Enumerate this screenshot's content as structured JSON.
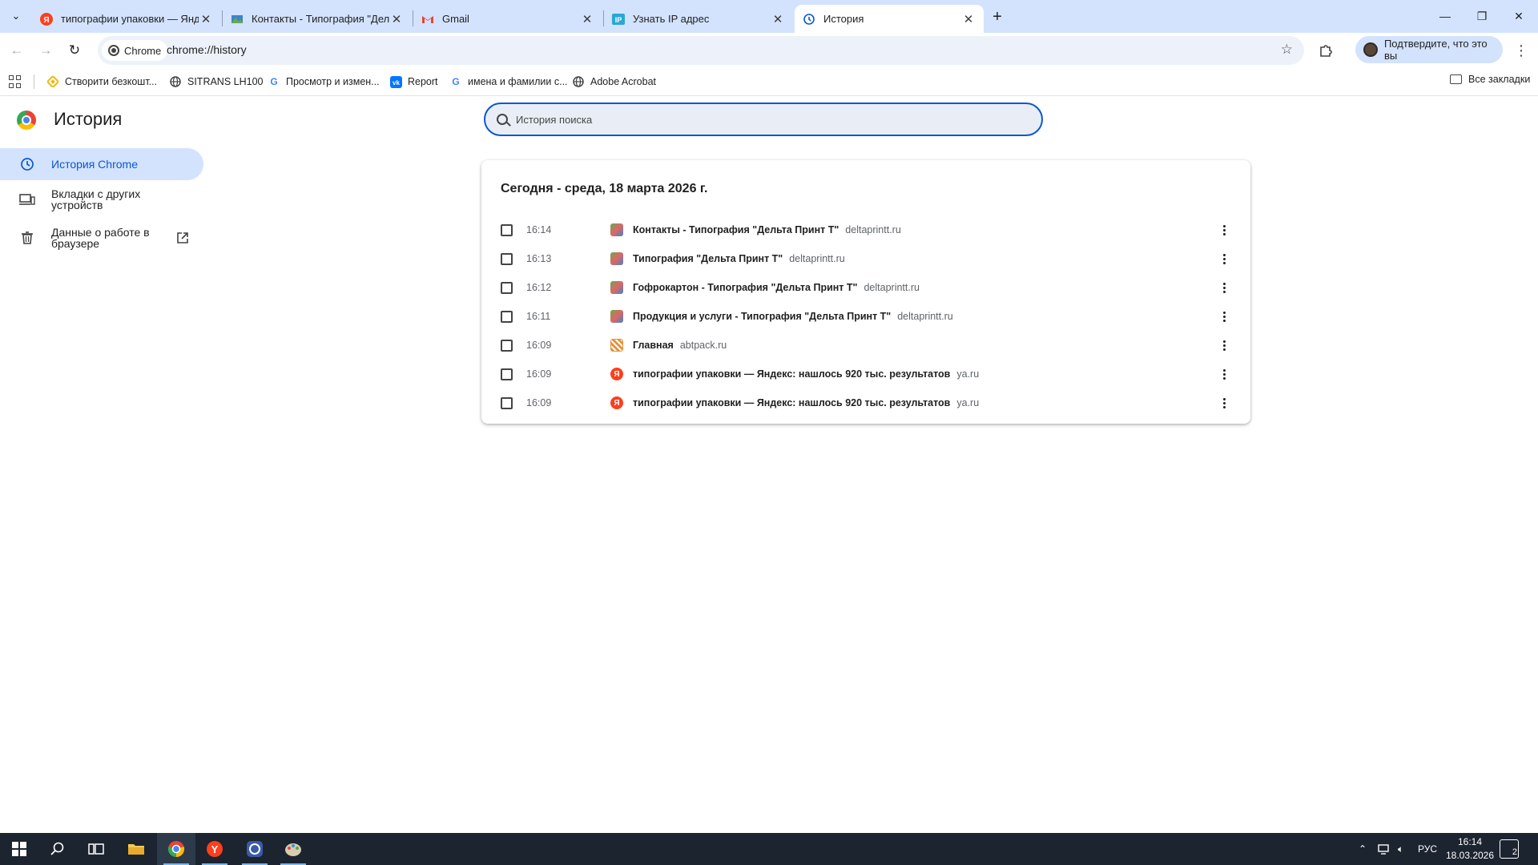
{
  "tabs": [
    {
      "title": "типографии упаковки — Яндекс",
      "favicon": "yandex-icon",
      "active": false
    },
    {
      "title": "Контакты - Типография \"Дельта Принт Т\"",
      "favicon": "delta-print-icon",
      "active": false
    },
    {
      "title": "Gmail",
      "favicon": "gmail-icon",
      "active": false
    },
    {
      "title": "Узнать IP адрес",
      "favicon": "ip-icon",
      "active": false
    },
    {
      "title": "История",
      "favicon": "history-icon",
      "active": true
    }
  ],
  "toolbar": {
    "chip_label": "Chrome",
    "url": "chrome://history",
    "profile_label": "Подтвердите, что это вы"
  },
  "bookmarks": {
    "items": [
      {
        "label": "Створити безкошт...",
        "icon": "binance-icon"
      },
      {
        "label": "SITRANS LH100",
        "icon": "globe-icon"
      },
      {
        "label": "Просмотр и измен...",
        "icon": "google-icon"
      },
      {
        "label": "Report",
        "icon": "vk-icon"
      },
      {
        "label": "имена и фамилии с...",
        "icon": "google-icon"
      },
      {
        "label": "Adobe Acrobat",
        "icon": "globe-icon"
      }
    ],
    "all_label": "Все закладки"
  },
  "page": {
    "title": "История",
    "search_placeholder": "История поиска"
  },
  "sidebar": {
    "items": [
      {
        "label": "История Chrome",
        "icon": "history-icon",
        "active": true
      },
      {
        "label": "Вкладки с других устройств",
        "icon": "devices-icon",
        "active": false
      },
      {
        "label": "Данные о работе в браузере",
        "icon": "trash-icon",
        "active": false
      }
    ]
  },
  "history": {
    "heading": "Сегодня - среда, 18 марта 2026 г.",
    "entries": [
      {
        "time": "16:14",
        "title": "Контакты - Типография \"Дельта Принт Т\"",
        "domain": "deltaprintt.ru",
        "favicon": "delta-print-icon"
      },
      {
        "time": "16:13",
        "title": "Типография \"Дельта Принт Т\"",
        "domain": "deltaprintt.ru",
        "favicon": "delta-print-icon"
      },
      {
        "time": "16:12",
        "title": "Гофрокартон - Типография \"Дельта Принт Т\"",
        "domain": "deltaprintt.ru",
        "favicon": "delta-print-icon"
      },
      {
        "time": "16:11",
        "title": "Продукция и услуги - Типография \"Дельта Принт Т\"",
        "domain": "deltaprintt.ru",
        "favicon": "delta-print-icon"
      },
      {
        "time": "16:09",
        "title": "Главная",
        "domain": "abtpack.ru",
        "favicon": "abtpack-icon"
      },
      {
        "time": "16:09",
        "title": "типографии упаковки — Яндекс: нашлось 920 тыс. результатов",
        "domain": "ya.ru",
        "favicon": "yandex-icon"
      },
      {
        "time": "16:09",
        "title": "типографии упаковки — Яндекс: нашлось 920 тыс. результатов",
        "domain": "ya.ru",
        "favicon": "yandex-icon"
      }
    ]
  },
  "taskbar": {
    "tray_language": "РУС",
    "clock_time": "16:14",
    "clock_date": "18.03.2026",
    "notification_count": "2"
  },
  "colors": {
    "accent": "#0b57d0",
    "tabstrip": "#d3e3fd",
    "taskbar": "#1c2430"
  }
}
